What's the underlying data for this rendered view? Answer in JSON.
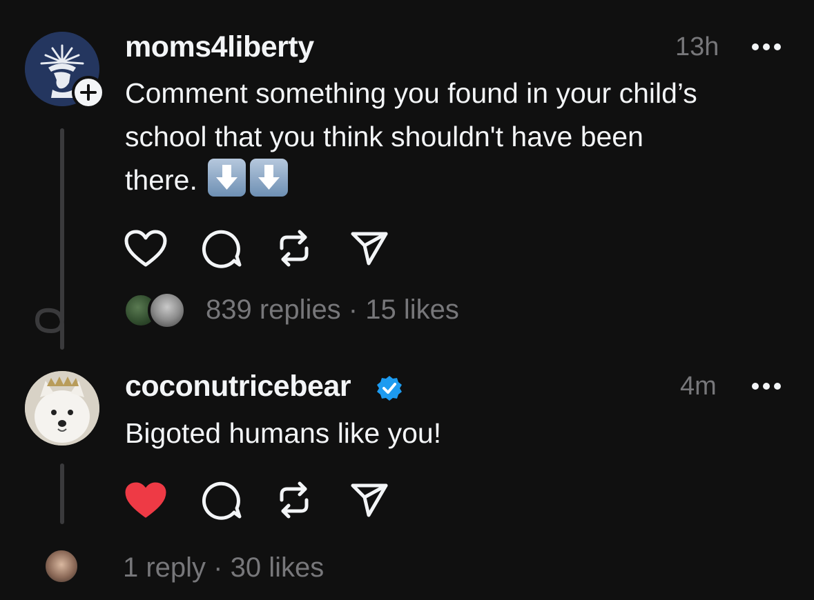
{
  "posts": [
    {
      "username": "moms4liberty",
      "time": "13h",
      "text_line1": "Comment something you found in your child’s",
      "text_line2": "school that you think shouldn't have been",
      "text_line3": "there.",
      "emoji": [
        "down-arrow-emoji",
        "down-arrow-emoji"
      ],
      "stats": "839 replies · 15 likes",
      "liked": false
    },
    {
      "username": "coconutricebear",
      "verified": true,
      "time": "4m",
      "text": "Bigoted humans like you!",
      "stats": "1 reply · 30 likes",
      "liked": true
    }
  ],
  "colors": {
    "background": "#101010",
    "text": "#f3f5f7",
    "secondary": "#77777a",
    "like_red": "#ee3a45",
    "verified_blue": "#1d9bf0"
  }
}
